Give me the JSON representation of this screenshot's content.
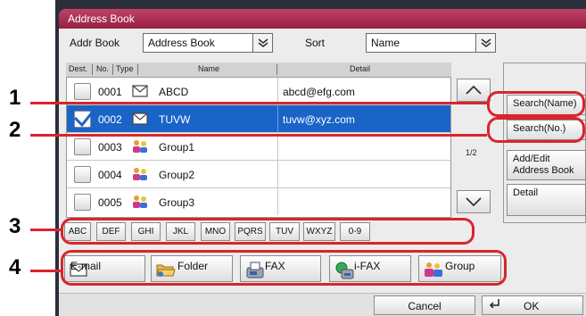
{
  "window": {
    "title": "Address Book"
  },
  "filter": {
    "addr_book_label": "Addr Book",
    "addr_book_value": "Address Book",
    "sort_label": "Sort",
    "sort_value": "Name"
  },
  "list": {
    "headers": {
      "dest": "Dest.",
      "no": "No.",
      "type": "Type",
      "name": "Name",
      "detail": "Detail"
    },
    "rows": [
      {
        "no": "0001",
        "type": "email",
        "name": "ABCD",
        "detail": "abcd@efg.com",
        "checked": false,
        "selected": false
      },
      {
        "no": "0002",
        "type": "email",
        "name": "TUVW",
        "detail": "tuvw@xyz.com",
        "checked": true,
        "selected": true
      },
      {
        "no": "0003",
        "type": "group",
        "name": "Group1",
        "detail": "",
        "checked": false,
        "selected": false
      },
      {
        "no": "0004",
        "type": "group",
        "name": "Group2",
        "detail": "",
        "checked": false,
        "selected": false
      },
      {
        "no": "0005",
        "type": "group",
        "name": "Group3",
        "detail": "",
        "checked": false,
        "selected": false
      }
    ],
    "page_indicator": "1/2"
  },
  "side_buttons": {
    "search_name": "Search(Name)",
    "search_no": "Search(No.)",
    "add_edit_line1": "Add/Edit",
    "add_edit_line2": "Address Book",
    "detail": "Detail"
  },
  "alpha_buttons": [
    "ABC",
    "DEF",
    "GHI",
    "JKL",
    "MNO",
    "PQRS",
    "TUV",
    "WXYZ",
    "0-9"
  ],
  "dest_types": [
    {
      "label": "E-mail",
      "icon": "envelope-icon"
    },
    {
      "label": "Folder",
      "icon": "folder-icon"
    },
    {
      "label": "FAX",
      "icon": "fax-icon"
    },
    {
      "label": "i-FAX",
      "icon": "ifax-icon"
    },
    {
      "label": "Group",
      "icon": "group-icon"
    }
  ],
  "footer": {
    "cancel": "Cancel",
    "ok": "OK"
  },
  "callouts": [
    "1",
    "2",
    "3",
    "4"
  ],
  "colors": {
    "title_bar": "#b0304f",
    "selection": "#1a64c8",
    "callout": "#d8262b"
  }
}
